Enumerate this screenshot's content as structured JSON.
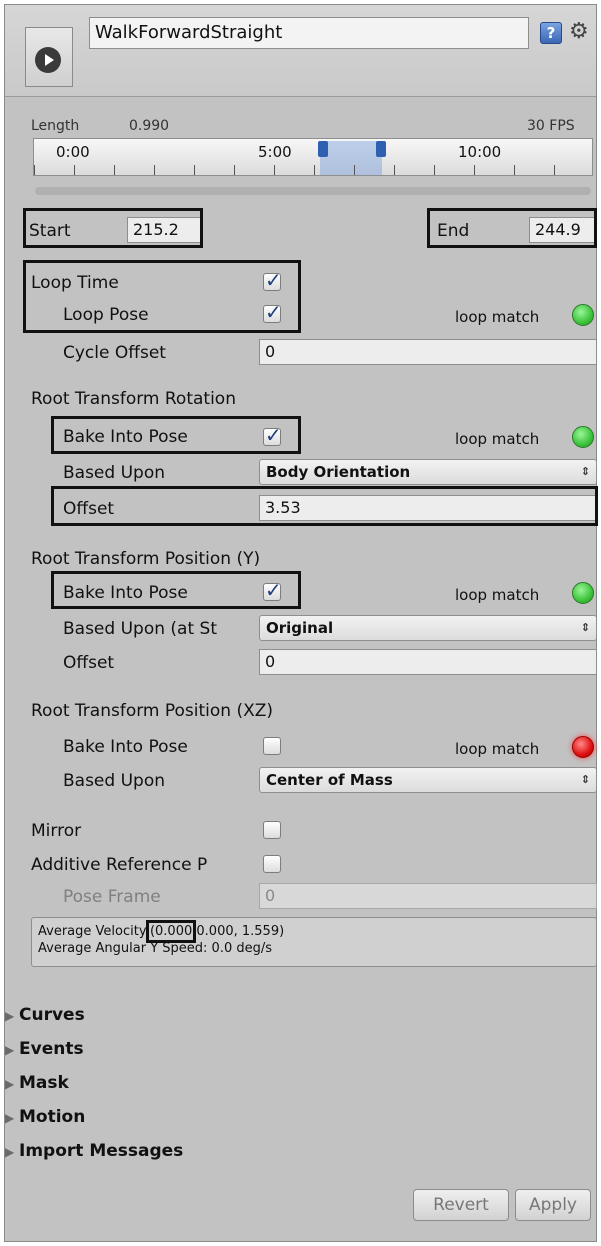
{
  "header": {
    "clip_name": "WalkForwardStraight",
    "play_icon": "play-icon",
    "help_icon": "help-icon",
    "gear_icon": "gear-icon"
  },
  "timeline": {
    "length_label": "Length",
    "length_value": "0.990",
    "fps": "30 FPS",
    "ticks": [
      "0:00",
      "5:00",
      "10:00"
    ]
  },
  "range": {
    "start_label": "Start",
    "start_value": "215.2",
    "end_label": "End",
    "end_value": "244.9"
  },
  "loop": {
    "loop_time_label": "Loop Time",
    "loop_time_checked": true,
    "loop_pose_label": "Loop Pose",
    "loop_pose_checked": true,
    "loop_match_label": "loop match",
    "cycle_offset_label": "Cycle Offset",
    "cycle_offset_value": "0"
  },
  "rotation": {
    "title": "Root Transform Rotation",
    "bake_label": "Bake Into Pose",
    "bake_checked": true,
    "loop_match_label": "loop match",
    "based_upon_label": "Based Upon",
    "based_upon_value": "Body Orientation",
    "offset_label": "Offset",
    "offset_value": "3.53"
  },
  "position_y": {
    "title": "Root Transform Position (Y)",
    "bake_label": "Bake Into Pose",
    "bake_checked": true,
    "loop_match_label": "loop match",
    "based_upon_label": "Based Upon (at St",
    "based_upon_value": "Original",
    "offset_label": "Offset",
    "offset_value": "0"
  },
  "position_xz": {
    "title": "Root Transform Position (XZ)",
    "bake_label": "Bake Into Pose",
    "bake_checked": false,
    "loop_match_label": "loop match",
    "based_upon_label": "Based Upon",
    "based_upon_value": "Center of Mass"
  },
  "misc": {
    "mirror_label": "Mirror",
    "additive_label": "Additive Reference P",
    "pose_frame_label": "Pose Frame",
    "pose_frame_value": "0"
  },
  "velocity": {
    "avg_velocity_label": "Average Velocity:",
    "avg_velocity_x": "(0.000",
    "avg_velocity_rest": "0.000, 1.559)",
    "avg_angular_label": "Average Angular Y Speed:",
    "avg_angular_value": "0.0 deg/s"
  },
  "foldouts": [
    "Curves",
    "Events",
    "Mask",
    "Motion",
    "Import Messages"
  ],
  "buttons": {
    "revert": "Revert",
    "apply": "Apply"
  },
  "colors": {
    "loop_match_ok": "#3cc43a",
    "loop_match_bad": "#e01010",
    "panel": "#c2c2c2"
  }
}
